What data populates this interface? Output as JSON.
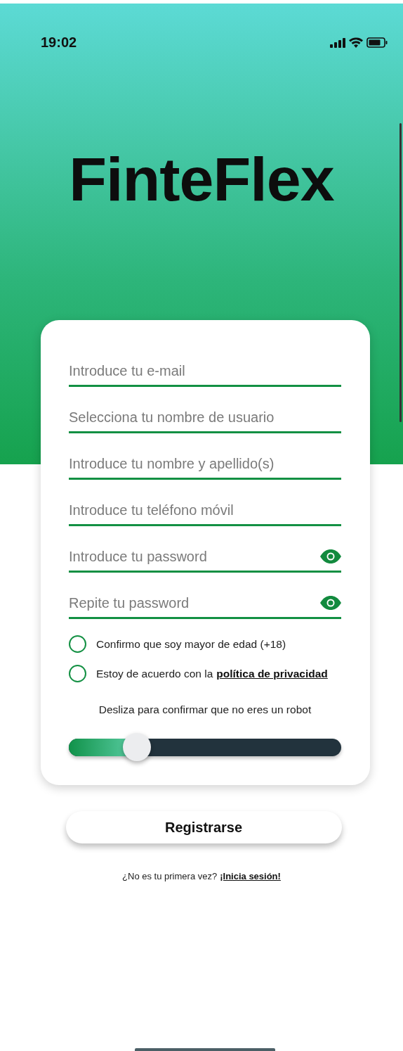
{
  "status_bar": {
    "time": "19:02"
  },
  "logo": "FinteFlex",
  "form": {
    "fields": [
      {
        "placeholder": "Introduce tu e-mail",
        "kind": "text"
      },
      {
        "placeholder": "Selecciona tu nombre de usuario",
        "kind": "text"
      },
      {
        "placeholder": "Introduce tu nombre y apellido(s)",
        "kind": "text"
      },
      {
        "placeholder": "Introduce tu teléfono móvil",
        "kind": "text"
      },
      {
        "placeholder": "Introduce tu password",
        "kind": "password"
      },
      {
        "placeholder": "Repite tu password",
        "kind": "password"
      }
    ],
    "checkboxes": [
      {
        "label": "Confirmo que soy mayor de edad (+18)",
        "checked": false
      },
      {
        "label": "Estoy de acuerdo con la",
        "link": "política de privacidad",
        "checked": false
      }
    ],
    "captcha": {
      "label": "Desliza para confirmar que no eres un robot",
      "level": 0.25
    }
  },
  "register_button": "Registrarse",
  "login_prompt": {
    "text": "¿No es tu primera vez?",
    "link": "¡Inicia sesión!"
  }
}
